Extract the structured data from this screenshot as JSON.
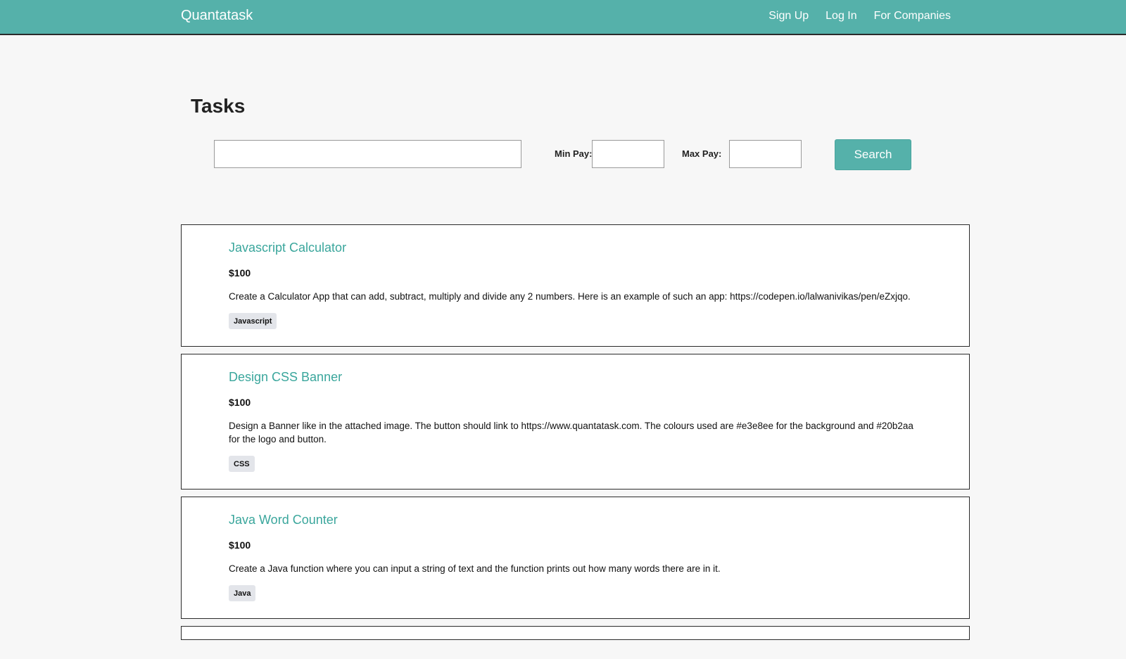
{
  "header": {
    "brand": "Quantatask",
    "nav": {
      "sign_up": "Sign Up",
      "log_in": "Log In",
      "for_companies": "For Companies"
    }
  },
  "main": {
    "title": "Tasks",
    "search": {
      "query_value": "",
      "query_placeholder": "",
      "min_pay_label": "Min Pay:",
      "min_pay_value": "",
      "max_pay_label": "Max Pay:",
      "max_pay_value": "",
      "button_label": "Search"
    },
    "tasks": [
      {
        "title": "Javascript Calculator",
        "pay": "$100",
        "description": "Create a Calculator App that can add, subtract, multiply and divide any 2 numbers. Here is an example of such an app: https://codepen.io/lalwanivikas/pen/eZxjqo.",
        "tags": [
          "Javascript"
        ]
      },
      {
        "title": "Design CSS Banner",
        "pay": "$100",
        "description": "Design a Banner like in the attached image. The button should link to https://www.quantatask.com. The colours used are #e3e8ee for the background and #20b2aa for the logo and button.",
        "tags": [
          "CSS"
        ]
      },
      {
        "title": "Java Word Counter",
        "pay": "$100",
        "description": "Create a Java function where you can input a string of text and the function prints out how many words there are in it.",
        "tags": [
          "Java"
        ]
      }
    ]
  },
  "colors": {
    "brand_teal": "#55b1aa",
    "link_teal": "#3aa69c",
    "page_background": "#f7f7f7",
    "tag_background": "#e3e5ea"
  }
}
